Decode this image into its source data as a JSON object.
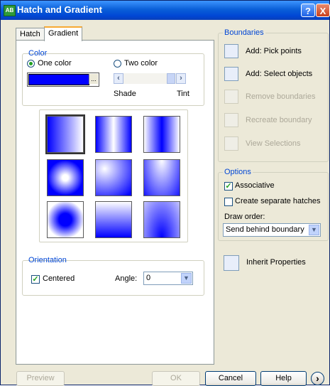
{
  "window": {
    "title": "Hatch and Gradient",
    "help_glyph": "?",
    "close_glyph": "X",
    "icon_text": "AB"
  },
  "tabs": [
    {
      "label": "Hatch"
    },
    {
      "label": "Gradient"
    }
  ],
  "color": {
    "legend": "Color",
    "one_color": "One color",
    "two_color": "Two color",
    "selected": "one_color",
    "swatch_color": "#0000ff",
    "browse": "...",
    "shade": "Shade",
    "tint": "Tint"
  },
  "patterns": [
    {
      "id": "linear",
      "selected": true
    },
    {
      "id": "cylinder",
      "selected": false
    },
    {
      "id": "inv-cylinder",
      "selected": false
    },
    {
      "id": "spherical",
      "selected": false
    },
    {
      "id": "hemispherical",
      "selected": false
    },
    {
      "id": "curved",
      "selected": false
    },
    {
      "id": "inv-spherical",
      "selected": false
    },
    {
      "id": "inv-hemispherical",
      "selected": false
    },
    {
      "id": "inv-curved",
      "selected": false
    }
  ],
  "orientation": {
    "legend": "Orientation",
    "centered": "Centered",
    "centered_checked": true,
    "angle_label": "Angle:",
    "angle_value": "0"
  },
  "boundaries": {
    "legend": "Boundaries",
    "items": [
      {
        "label": "Add: Pick points",
        "enabled": true,
        "icon": "pick-points-icon"
      },
      {
        "label": "Add: Select objects",
        "enabled": true,
        "icon": "select-objects-icon"
      },
      {
        "label": "Remove boundaries",
        "enabled": false,
        "icon": "remove-boundaries-icon"
      },
      {
        "label": "Recreate boundary",
        "enabled": false,
        "icon": "recreate-boundary-icon"
      },
      {
        "label": "View Selections",
        "enabled": false,
        "icon": "magnifier-icon"
      }
    ]
  },
  "options": {
    "legend": "Options",
    "associative": "Associative",
    "associative_checked": true,
    "separate": "Create separate hatches",
    "separate_checked": false,
    "draw_order_label": "Draw order:",
    "draw_order_value": "Send behind boundary"
  },
  "inherit": "Inherit Properties",
  "footer": {
    "preview": "Preview",
    "ok": "OK",
    "cancel": "Cancel",
    "help": "Help",
    "more_glyph": "›"
  }
}
